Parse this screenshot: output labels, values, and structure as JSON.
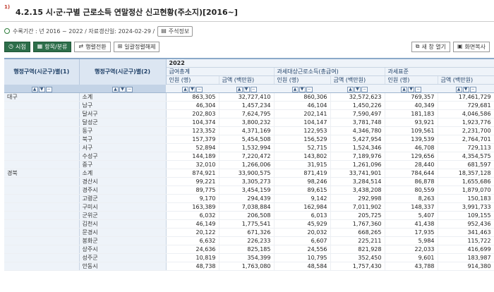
{
  "title": {
    "sup": "1)",
    "text": "4.2.15 시·군·구별 근로소득 연말정산 신고현황(주소지)[2016~]"
  },
  "meta": {
    "period": "수록기간 : 년 2016 ~ 2022 / 자료갱신일: 2024-02-29 /",
    "note_button": "주석정보"
  },
  "toolbar": {
    "time_button": "시점",
    "item_button": "항목/분류",
    "rowcol_button": "행렬전환",
    "unit_button": "일괄정렬해제",
    "new_window_button": "새 창 열기",
    "screen_copy_button": "화면복사"
  },
  "table": {
    "row_header_1": "행정구역(시군구)별(1)",
    "row_header_2": "행정구역(시군구)별(2)",
    "year": "2022",
    "groups": [
      "급여총계",
      "과세대상근로소득(총급여)",
      "과세표준"
    ],
    "subcols": [
      "인원 (명)",
      "금액 (백만원)",
      "인원 (명)",
      "금액 (백만원)",
      "인원 (명)",
      "금액 (백만원)"
    ],
    "rows": [
      {
        "region": "대구",
        "sub": "소계",
        "v": [
          "863,305",
          "32,727,410",
          "860,306",
          "32,572,623",
          "769,357",
          "17,461,729"
        ]
      },
      {
        "region": "",
        "sub": "남구",
        "v": [
          "46,304",
          "1,457,234",
          "46,104",
          "1,450,226",
          "40,349",
          "729,681"
        ]
      },
      {
        "region": "",
        "sub": "달서구",
        "v": [
          "202,803",
          "7,624,795",
          "202,141",
          "7,590,497",
          "181,183",
          "4,046,586"
        ]
      },
      {
        "region": "",
        "sub": "달성군",
        "v": [
          "104,374",
          "3,800,232",
          "104,147",
          "3,781,748",
          "93,921",
          "1,923,776"
        ]
      },
      {
        "region": "",
        "sub": "동구",
        "v": [
          "123,352",
          "4,371,169",
          "122,953",
          "4,346,780",
          "109,561",
          "2,231,700"
        ]
      },
      {
        "region": "",
        "sub": "북구",
        "v": [
          "157,379",
          "5,454,508",
          "156,529",
          "5,427,954",
          "139,539",
          "2,764,701"
        ]
      },
      {
        "region": "",
        "sub": "서구",
        "v": [
          "52,894",
          "1,532,994",
          "52,715",
          "1,524,346",
          "46,708",
          "729,113"
        ]
      },
      {
        "region": "",
        "sub": "수성구",
        "v": [
          "144,189",
          "7,220,472",
          "143,802",
          "7,189,976",
          "129,656",
          "4,354,575"
        ]
      },
      {
        "region": "",
        "sub": "중구",
        "v": [
          "32,010",
          "1,266,006",
          "31,915",
          "1,261,096",
          "28,440",
          "681,597"
        ]
      },
      {
        "region": "경북",
        "sub": "소계",
        "v": [
          "874,921",
          "33,900,575",
          "871,419",
          "33,741,901",
          "784,644",
          "18,357,128"
        ]
      },
      {
        "region": "",
        "sub": "경산시",
        "v": [
          "99,221",
          "3,305,273",
          "98,246",
          "3,284,514",
          "86,878",
          "1,655,686"
        ]
      },
      {
        "region": "",
        "sub": "경주시",
        "v": [
          "89,775",
          "3,454,159",
          "89,615",
          "3,438,208",
          "80,559",
          "1,879,070"
        ]
      },
      {
        "region": "",
        "sub": "고령군",
        "v": [
          "9,170",
          "294,439",
          "9,142",
          "292,998",
          "8,263",
          "150,183"
        ]
      },
      {
        "region": "",
        "sub": "구미시",
        "v": [
          "163,389",
          "7,038,884",
          "162,984",
          "7,011,902",
          "148,337",
          "3,991,733"
        ]
      },
      {
        "region": "",
        "sub": "군위군",
        "v": [
          "6,032",
          "206,508",
          "6,013",
          "205,725",
          "5,407",
          "109,155"
        ]
      },
      {
        "region": "",
        "sub": "김천시",
        "v": [
          "46,149",
          "1,775,541",
          "45,929",
          "1,767,360",
          "41,438",
          "952,436"
        ]
      },
      {
        "region": "",
        "sub": "문경시",
        "v": [
          "20,122",
          "671,326",
          "20,032",
          "668,265",
          "17,935",
          "341,463"
        ]
      },
      {
        "region": "",
        "sub": "봉화군",
        "v": [
          "6,632",
          "226,233",
          "6,607",
          "225,211",
          "5,984",
          "115,722"
        ]
      },
      {
        "region": "",
        "sub": "상주시",
        "v": [
          "24,636",
          "825,185",
          "24,556",
          "821,928",
          "22,033",
          "416,699"
        ]
      },
      {
        "region": "",
        "sub": "성주군",
        "v": [
          "10,819",
          "354,399",
          "10,795",
          "352,450",
          "9,601",
          "183,987"
        ]
      },
      {
        "region": "",
        "sub": "안동시",
        "v": [
          "48,738",
          "1,763,080",
          "48,584",
          "1,757,430",
          "43,788",
          "914,380"
        ]
      }
    ]
  }
}
